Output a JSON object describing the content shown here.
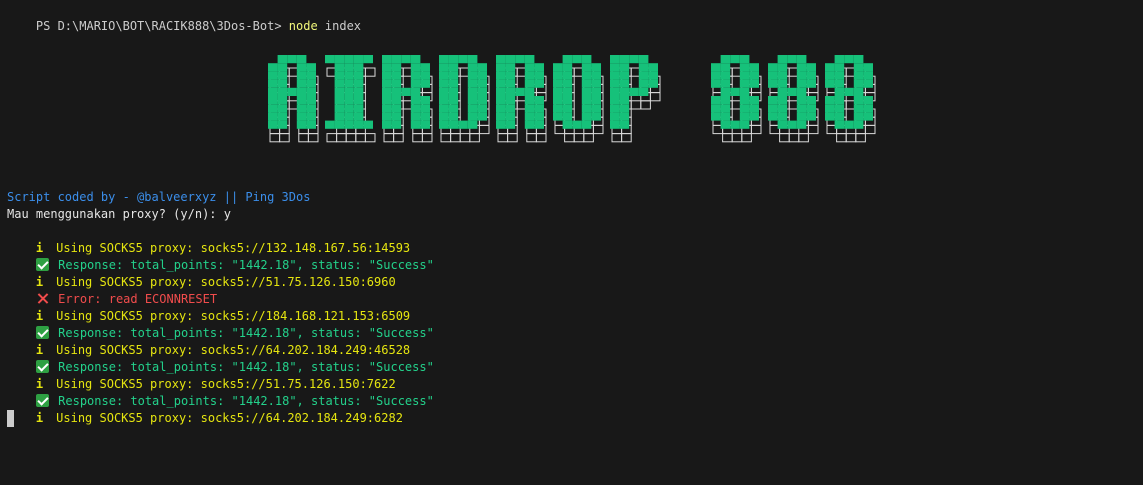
{
  "terminal": {
    "prompt": {
      "path": "PS D:\\MARIO\\BOT\\RACIK888\\3Dos-Bot> ",
      "command": "node",
      "args": " index"
    },
    "banner": {
      "text": "AIRDROP 888",
      "fill_color": "#16c17a",
      "outline_color": "#d9d9d9"
    },
    "credit": "Script coded by - @balveerxyz || Ping 3Dos",
    "question": "Mau menggunakan proxy? (y/n): y",
    "logs": [
      {
        "kind": "info",
        "icon": "info-icon",
        "text": "Using SOCKS5 proxy: socks5://132.148.167.56:14593"
      },
      {
        "kind": "success",
        "icon": "check-icon",
        "text": "Response: total_points: \"1442.18\", status: \"Success\""
      },
      {
        "kind": "info",
        "icon": "info-icon",
        "text": "Using SOCKS5 proxy: socks5://51.75.126.150:6960"
      },
      {
        "kind": "error",
        "icon": "cross-icon",
        "text": "Error: read ECONNRESET"
      },
      {
        "kind": "info",
        "icon": "info-icon",
        "text": "Using SOCKS5 proxy: socks5://184.168.121.153:6509"
      },
      {
        "kind": "success",
        "icon": "check-icon",
        "text": "Response: total_points: \"1442.18\", status: \"Success\""
      },
      {
        "kind": "info",
        "icon": "info-icon",
        "text": "Using SOCKS5 proxy: socks5://64.202.184.249:46528"
      },
      {
        "kind": "success",
        "icon": "check-icon",
        "text": "Response: total_points: \"1442.18\", status: \"Success\""
      },
      {
        "kind": "info",
        "icon": "info-icon",
        "text": "Using SOCKS5 proxy: socks5://51.75.126.150:7622"
      },
      {
        "kind": "success",
        "icon": "check-icon",
        "text": "Response: total_points: \"1442.18\", status: \"Success\""
      },
      {
        "kind": "info",
        "icon": "info-icon",
        "text": "Using SOCKS5 proxy: socks5://64.202.184.249:6282"
      }
    ]
  }
}
